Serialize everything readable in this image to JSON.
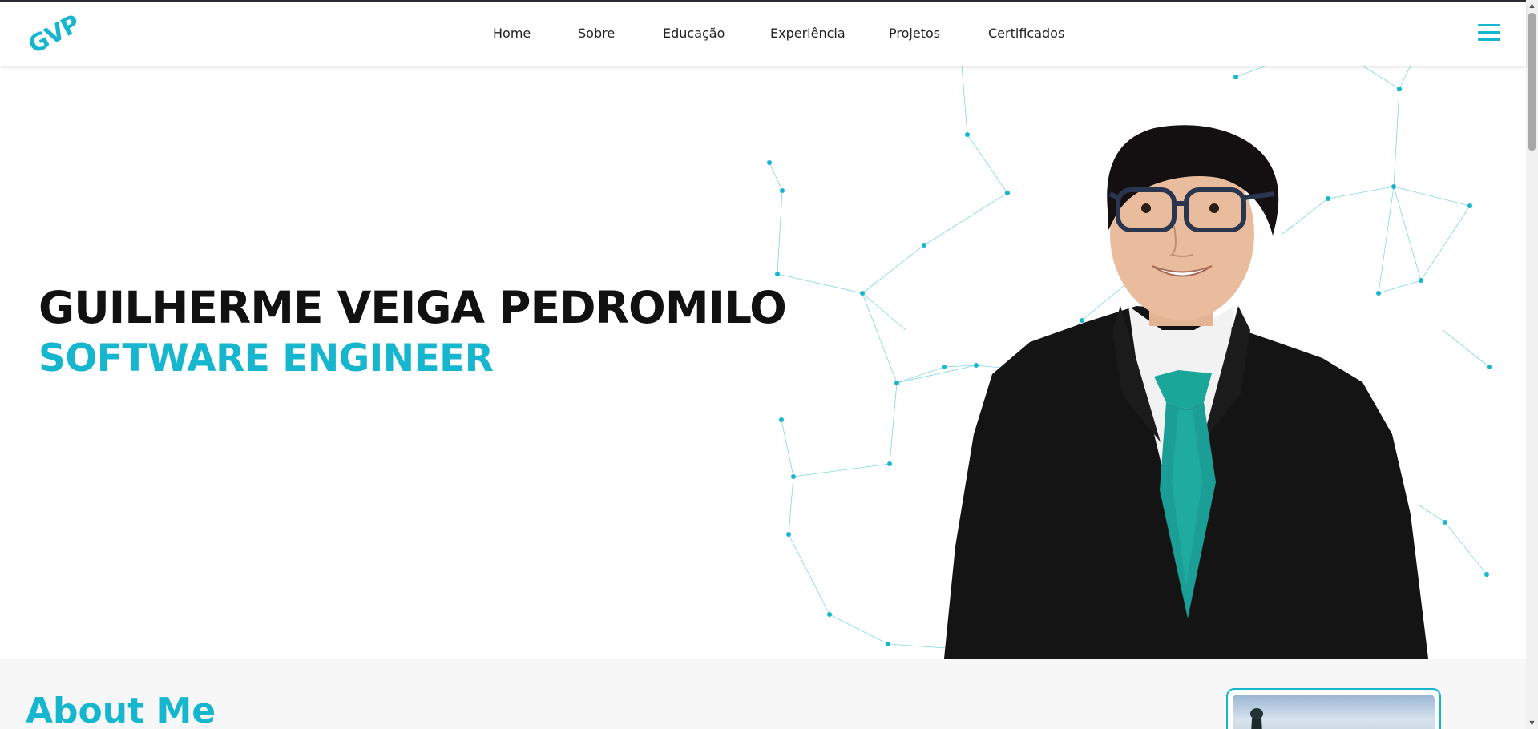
{
  "logo": {
    "text": "GVP"
  },
  "nav": {
    "items": [
      {
        "label": "Home"
      },
      {
        "label": "Sobre"
      },
      {
        "label": "Educação"
      },
      {
        "label": "Experiência"
      },
      {
        "label": "Projetos"
      },
      {
        "label": "Certificados"
      }
    ],
    "menu_icon": "hamburger-icon"
  },
  "hero": {
    "name": "GUILHERME VEIGA PEDROMILO",
    "role": "SOFTWARE ENGINEER"
  },
  "about": {
    "title": "About Me"
  },
  "colors": {
    "accent": "#17b6cf",
    "text": "#111111",
    "tie": "#1a9e95"
  }
}
